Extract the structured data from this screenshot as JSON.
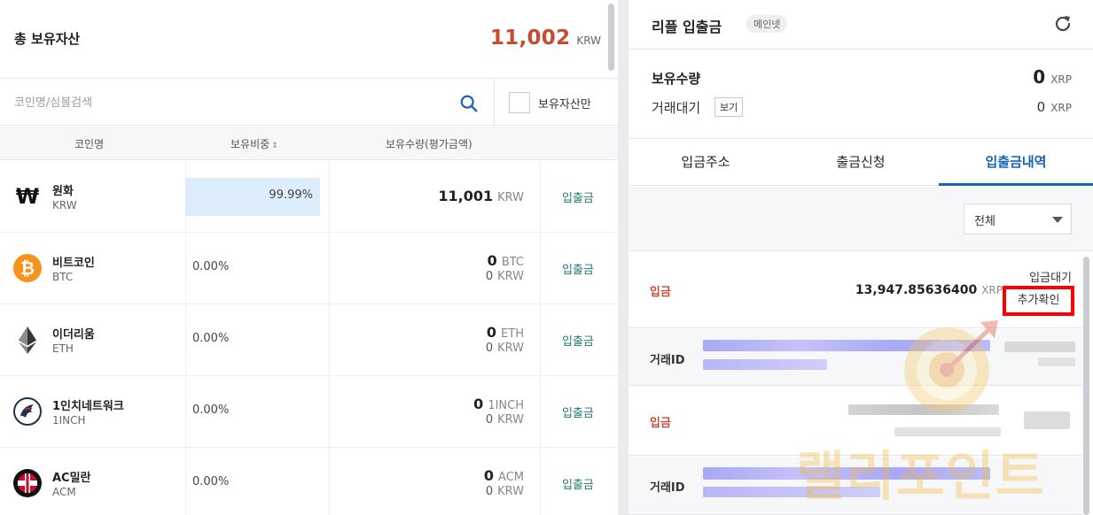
{
  "portfolio": {
    "total_label": "총 보유자산",
    "total_value": "11,002",
    "total_unit": "KRW",
    "search_placeholder": "코인명/심볼검색",
    "only_holdings_label": "보유자산만",
    "columns": {
      "name": "코인명",
      "ratio": "보유비중",
      "ratio_sort": "⇕",
      "amount": "보유수량(평가금액)"
    },
    "link_label": "입출금",
    "coins": [
      {
        "name": "원화",
        "symbol": "KRW",
        "ratio": "99.99%",
        "amount": "11,001",
        "amount_unit": "KRW",
        "krw": "",
        "icon": "won-icon",
        "ratio_fraction": 0.9999
      },
      {
        "name": "비트코인",
        "symbol": "BTC",
        "ratio": "0.00%",
        "amount": "0",
        "amount_unit": "BTC",
        "krw": "0",
        "krw_unit": "KRW",
        "icon": "bitcoin-icon"
      },
      {
        "name": "이더리움",
        "symbol": "ETH",
        "ratio": "0.00%",
        "amount": "0",
        "amount_unit": "ETH",
        "krw": "0",
        "krw_unit": "KRW",
        "icon": "ethereum-icon"
      },
      {
        "name": "1인치네트워크",
        "symbol": "1INCH",
        "ratio": "0.00%",
        "amount": "0",
        "amount_unit": "1INCH",
        "krw": "0",
        "krw_unit": "KRW",
        "icon": "1inch-icon"
      },
      {
        "name": "AC밀란",
        "symbol": "ACM",
        "ratio": "0.00%",
        "amount": "0",
        "amount_unit": "ACM",
        "krw": "0",
        "krw_unit": "KRW",
        "icon": "acmilan-icon"
      }
    ]
  },
  "detail": {
    "title": "리플 입출금",
    "network_badge": "메인넷",
    "holding_label": "보유수량",
    "holding_value": "0",
    "holding_unit": "XRP",
    "pending_label": "거래대기",
    "view_button": "보기",
    "pending_value": "0",
    "pending_unit": "XRP",
    "tabs": [
      "입금주소",
      "출금신청",
      "입출금내역"
    ],
    "active_tab": 2,
    "filter": {
      "selected": "전체"
    },
    "transactions": [
      {
        "type": "입금",
        "amount": "13,947.85636400",
        "unit": "XRP",
        "status": "입금대기",
        "action": "추가확인"
      },
      {
        "type": "입금"
      }
    ],
    "txid_label": "거래ID"
  },
  "colors": {
    "accent": "#1763b6",
    "deposit": "#c84a31",
    "link": "#1d7a6e",
    "highlight": "#ff0000"
  },
  "watermark": {
    "text": "랠리포인트"
  }
}
